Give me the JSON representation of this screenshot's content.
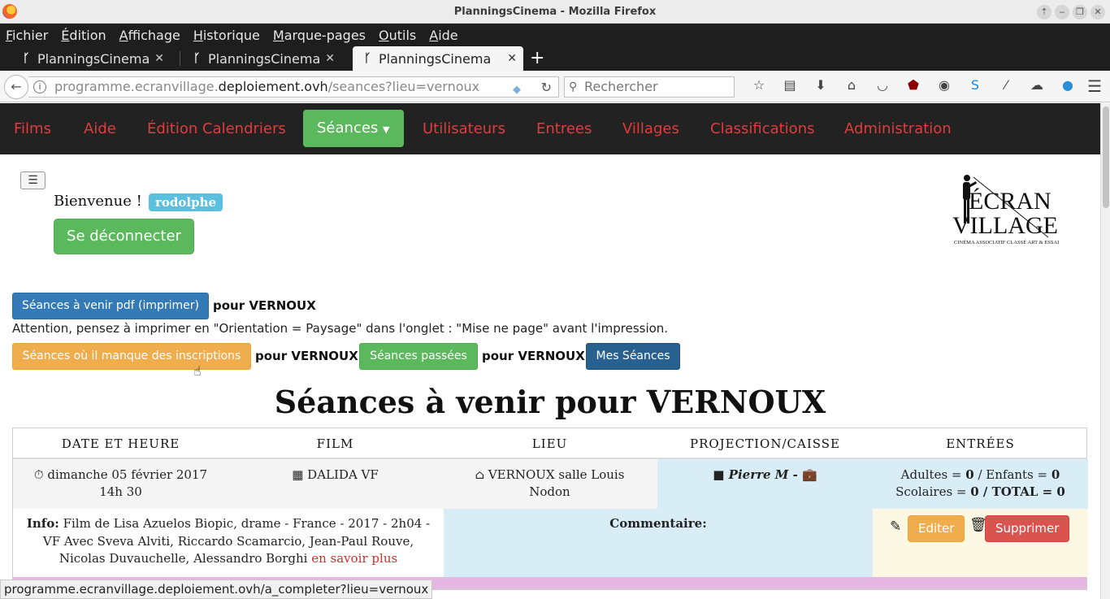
{
  "window": {
    "title": "PlanningsCinema - Mozilla Firefox"
  },
  "menubar": {
    "items": [
      "Fichier",
      "Édition",
      "Affichage",
      "Historique",
      "Marque-pages",
      "Outils",
      "Aide"
    ]
  },
  "tabs": [
    {
      "label": "PlanningsCinema",
      "active": false
    },
    {
      "label": "PlanningsCinema",
      "active": false
    },
    {
      "label": "PlanningsCinema",
      "active": true
    }
  ],
  "navbar": {
    "url_prefix": "programme.ecranvillage.",
    "url_domain": "deploiement.ovh",
    "url_path": "/seances?lieu=vernoux",
    "search_placeholder": "Rechercher"
  },
  "site_nav": {
    "films": "Films",
    "aide": "Aide",
    "edition": "Édition Calendriers",
    "seances": "Séances",
    "utilisateurs": "Utilisateurs",
    "entrees": "Entrees",
    "villages": "Villages",
    "classifications": "Classifications",
    "administration": "Administration"
  },
  "colors": {
    "nav_bg": "#222222",
    "nav_link": "#e03c3c",
    "success": "#5cb85c",
    "primary": "#337ab7",
    "warning": "#f0ad4e",
    "danger": "#d9534f",
    "info": "#5bc0de"
  },
  "header": {
    "welcome": "Bienvenue !",
    "user": "rodolphe",
    "logout": "Se déconnecter",
    "logo_line1": "ÉCRAN",
    "logo_line2": "VILLAGE",
    "logo_tagline": "CINÉMA ASSOCIATIF CLASSÉ ART & ESSAI"
  },
  "actions": {
    "pdf_button": "Séances à venir pdf (imprimer)",
    "for_place": "pour VERNOUX",
    "warning": "Attention, pensez à imprimer en \"Orientation = Paysage\" dans l'onglet : \"Mise ne page\" avant l'impression.",
    "missing_button": "Séances où il manque des inscriptions",
    "past_button": "Séances passées",
    "mine_button": "Mes Séances"
  },
  "page_title": "Séances à venir pour VERNOUX",
  "table": {
    "headers": [
      "DATE ET HEURE",
      "FILM",
      "LIEU",
      "PROJECTION/CAISSE",
      "ENTRÉES"
    ],
    "rows": [
      {
        "date": "dimanche 05 février 2017",
        "time": "14h 30",
        "film": "DALIDA VF",
        "lieu_line1": "VERNOUX salle Louis",
        "lieu_line2": "Nodon",
        "projection": "Pierre M",
        "entrees_line1_a": "Adultes = ",
        "adultes": "0",
        "entrees_line1_b": " / Enfants = ",
        "enfants": "0",
        "entrees_line2_a": "Scolaires = ",
        "scolaires": "0",
        "entrees_line2_b": " / TOTAL = ",
        "total": "0",
        "info_label": "Info:",
        "info_line1": "Film de Lisa Azuelos Biopic, drame - France - 2017 - 2h04 -",
        "info_line2": "VF Avec Sveva Alviti, Riccardo Scamarcio, Jean-Paul Rouve,",
        "info_line3": "Nicolas Duvauchelle, Alessandro Borghi",
        "info_link": "en savoir plus",
        "comment_label": "Commentaire:",
        "edit": "Editer",
        "delete": "Supprimer"
      }
    ]
  },
  "statusbar": "programme.ecranvillage.deploiement.ovh/a_completer?lieu=vernoux"
}
